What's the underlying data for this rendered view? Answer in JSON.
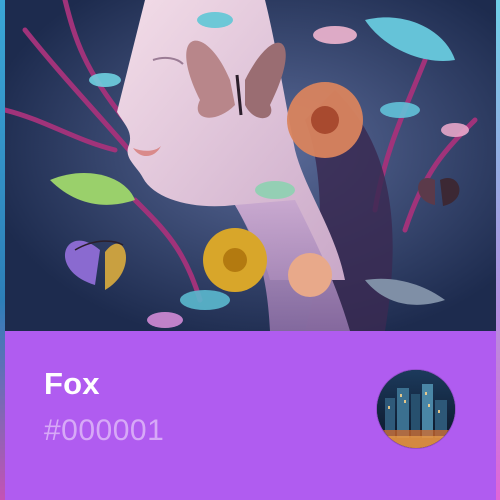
{
  "card": {
    "name": "Fox",
    "id": "#000001"
  },
  "artwork": {
    "icon": "surreal-portrait-artwork"
  },
  "owner": {
    "icon": "city-night-avatar"
  },
  "colors": {
    "panel": "#b05cf0",
    "name_text": "#ffffff",
    "id_text": "#d7a9f7",
    "artwork_bg": "#24335a"
  }
}
